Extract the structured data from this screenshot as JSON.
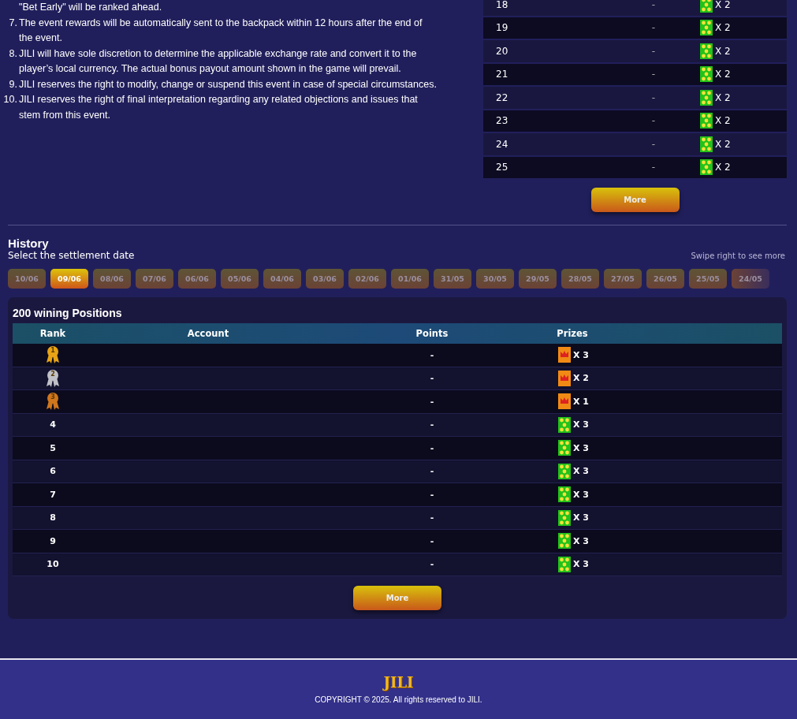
{
  "rules": {
    "continuation": "\"Bet Early\" will be ranked ahead.",
    "items": [
      {
        "number": "7.",
        "text": "The event rewards will be automatically sent to the backpack within 12 hours after the end of the event."
      },
      {
        "number": "8.",
        "text": "JILI will have sole discretion to determine the applicable exchange rate and convert it to the player’s local currency. The actual bonus payout amount shown in the game will prevail."
      },
      {
        "number": "9.",
        "text": "JILI reserves the right to modify, change or suspend this event in case of special circumstances."
      },
      {
        "number": "10.",
        "text": "JILI reserves the right of final interpretation regarding any related objections and issues that stem from this event."
      }
    ]
  },
  "ranking": {
    "rows": [
      {
        "rank": "18",
        "points": "-",
        "prize": {
          "kind": "stars",
          "count": "X 2"
        }
      },
      {
        "rank": "19",
        "points": "-",
        "prize": {
          "kind": "stars",
          "count": "X 2"
        }
      },
      {
        "rank": "20",
        "points": "-",
        "prize": {
          "kind": "stars",
          "count": "X 2"
        }
      },
      {
        "rank": "21",
        "points": "-",
        "prize": {
          "kind": "stars",
          "count": "X 2"
        }
      },
      {
        "rank": "22",
        "points": "-",
        "prize": {
          "kind": "stars",
          "count": "X 2"
        }
      },
      {
        "rank": "23",
        "points": "-",
        "prize": {
          "kind": "stars",
          "count": "X 2"
        }
      },
      {
        "rank": "24",
        "points": "-",
        "prize": {
          "kind": "stars",
          "count": "X 2"
        }
      },
      {
        "rank": "25",
        "points": "-",
        "prize": {
          "kind": "stars",
          "count": "X 2"
        }
      }
    ],
    "more": "More"
  },
  "history": {
    "title": "History",
    "subtitle": "Select the settlement date",
    "hint": "Swipe right to see more",
    "dates": [
      {
        "label": "10/06",
        "selected": false
      },
      {
        "label": "09/06",
        "selected": true
      },
      {
        "label": "08/06",
        "selected": false
      },
      {
        "label": "07/06",
        "selected": false
      },
      {
        "label": "06/06",
        "selected": false
      },
      {
        "label": "05/06",
        "selected": false
      },
      {
        "label": "04/06",
        "selected": false
      },
      {
        "label": "03/06",
        "selected": false
      },
      {
        "label": "02/06",
        "selected": false
      },
      {
        "label": "01/06",
        "selected": false
      },
      {
        "label": "31/05",
        "selected": false
      },
      {
        "label": "30/05",
        "selected": false
      },
      {
        "label": "29/05",
        "selected": false
      },
      {
        "label": "28/05",
        "selected": false
      },
      {
        "label": "27/05",
        "selected": false
      },
      {
        "label": "26/05",
        "selected": false
      },
      {
        "label": "25/05",
        "selected": false
      },
      {
        "label": "24/05",
        "selected": false
      }
    ],
    "panel_title": "200 wining Positions",
    "columns": [
      "Rank",
      "Account",
      "Points",
      "Prizes"
    ],
    "rows": [
      {
        "kind": "medal",
        "color": "#e8a416",
        "rank": "1",
        "points": "-",
        "prize": {
          "kind": "crown",
          "count": "X 3"
        }
      },
      {
        "kind": "medal",
        "color": "#c0c0c8",
        "rank": "2",
        "points": "-",
        "prize": {
          "kind": "crown",
          "count": "X 2"
        }
      },
      {
        "kind": "medal",
        "color": "#d0761c",
        "rank": "3",
        "points": "-",
        "prize": {
          "kind": "crown",
          "count": "X 1"
        }
      },
      {
        "kind": "number",
        "rank": "4",
        "points": "-",
        "prize": {
          "kind": "stars",
          "count": "X 3"
        }
      },
      {
        "kind": "number",
        "rank": "5",
        "points": "-",
        "prize": {
          "kind": "stars",
          "count": "X 3"
        }
      },
      {
        "kind": "number",
        "rank": "6",
        "points": "-",
        "prize": {
          "kind": "stars",
          "count": "X 3"
        }
      },
      {
        "kind": "number",
        "rank": "7",
        "points": "-",
        "prize": {
          "kind": "stars",
          "count": "X 3"
        }
      },
      {
        "kind": "number",
        "rank": "8",
        "points": "-",
        "prize": {
          "kind": "stars",
          "count": "X 3"
        }
      },
      {
        "kind": "number",
        "rank": "9",
        "points": "-",
        "prize": {
          "kind": "stars",
          "count": "X 3"
        }
      },
      {
        "kind": "number",
        "rank": "10",
        "points": "-",
        "prize": {
          "kind": "stars",
          "count": "X 3"
        }
      }
    ],
    "more": "More"
  },
  "footer": {
    "logo": "JILI",
    "copyright": "COPYRIGHT © 2025. All rights reserved to JILI."
  }
}
